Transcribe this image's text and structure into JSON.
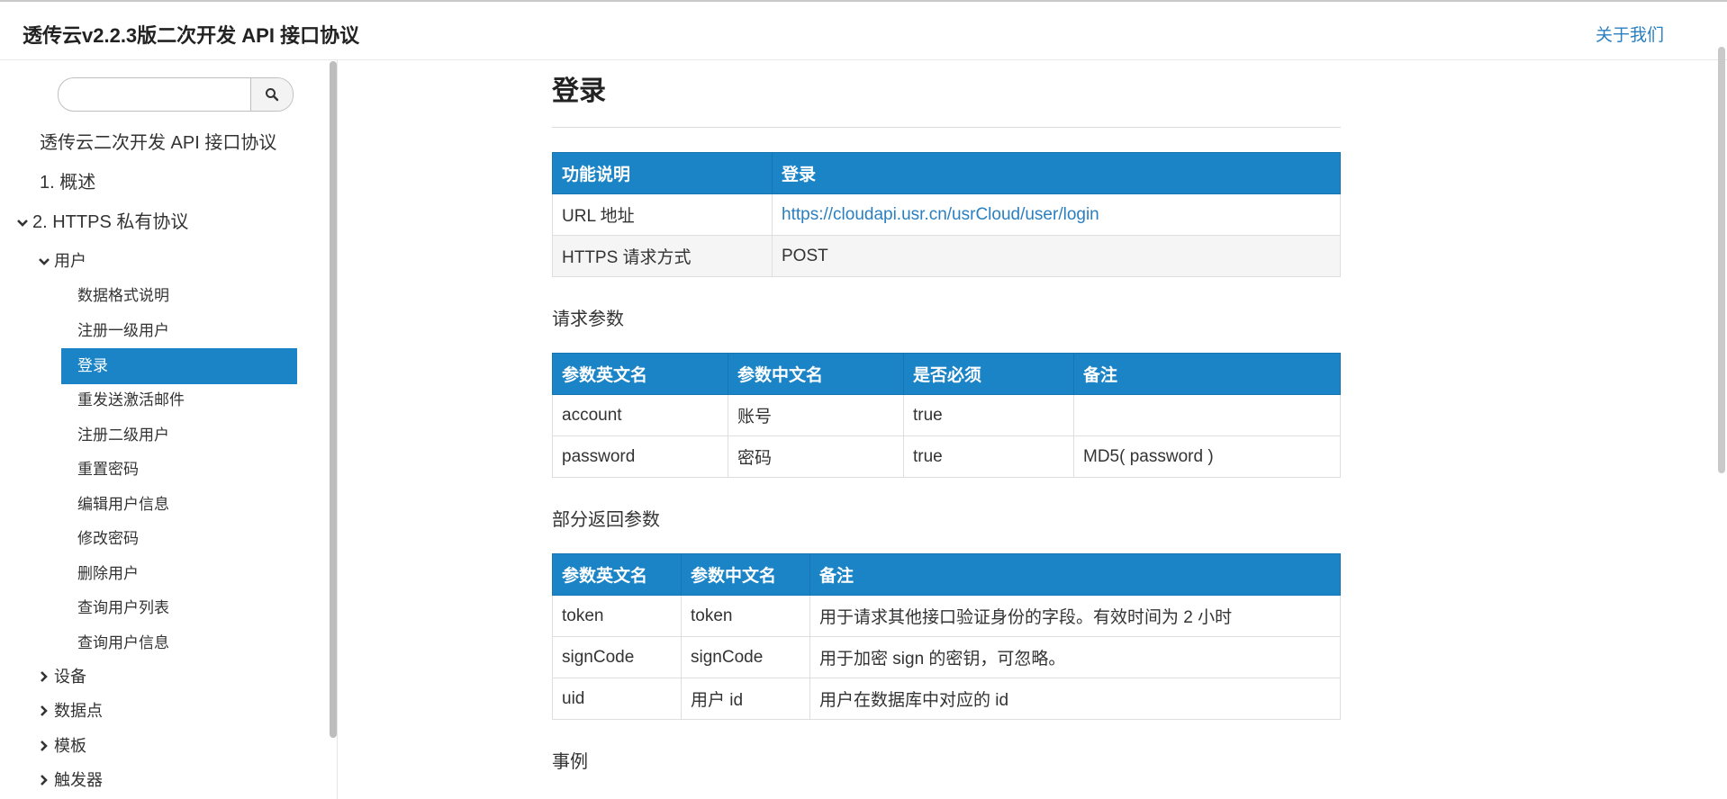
{
  "header": {
    "brand": "透传云v2.2.3版二次开发 API 接口协议",
    "about": "关于我们"
  },
  "sidebar": {
    "search": {
      "value": "",
      "placeholder": ""
    },
    "items": [
      {
        "label": "透传云二次开发 API 接口协议"
      },
      {
        "label": "1. 概述"
      },
      {
        "label": "2. HTTPS 私有协议"
      },
      {
        "label": "用户"
      },
      {
        "label": "数据格式说明"
      },
      {
        "label": "注册一级用户"
      },
      {
        "label": "登录"
      },
      {
        "label": "重发送激活邮件"
      },
      {
        "label": "注册二级用户"
      },
      {
        "label": "重置密码"
      },
      {
        "label": "编辑用户信息"
      },
      {
        "label": "修改密码"
      },
      {
        "label": "删除用户"
      },
      {
        "label": "查询用户列表"
      },
      {
        "label": "查询用户信息"
      },
      {
        "label": "设备"
      },
      {
        "label": "数据点"
      },
      {
        "label": "模板"
      },
      {
        "label": "触发器"
      }
    ],
    "active_item": "登录"
  },
  "main": {
    "title": "登录",
    "info_table": {
      "headers": [
        "功能说明",
        "登录"
      ],
      "rows": [
        [
          "URL 地址",
          "https://cloudapi.usr.cn/usrCloud/user/login"
        ],
        [
          "HTTPS 请求方式",
          "POST"
        ]
      ]
    },
    "request_heading": "请求参数",
    "request_table": {
      "headers": [
        "参数英文名",
        "参数中文名",
        "是否必须",
        "备注"
      ],
      "rows": [
        [
          "account",
          "账号",
          "true",
          ""
        ],
        [
          "password",
          "密码",
          "true",
          "MD5( password )"
        ]
      ]
    },
    "response_heading": "部分返回参数",
    "response_table": {
      "headers": [
        "参数英文名",
        "参数中文名",
        "备注"
      ],
      "rows": [
        [
          "token",
          "token",
          "用于请求其他接口验证身份的字段。有效时间为 2 小时"
        ],
        [
          "signCode",
          "signCode",
          "用于加密 sign 的密钥，可忽略。"
        ],
        [
          "uid",
          "用户 id",
          "用户在数据库中对应的 id"
        ]
      ]
    },
    "example_heading": "事例"
  },
  "colors": {
    "accent": "#1a84c6",
    "link": "#2a7fc0"
  }
}
